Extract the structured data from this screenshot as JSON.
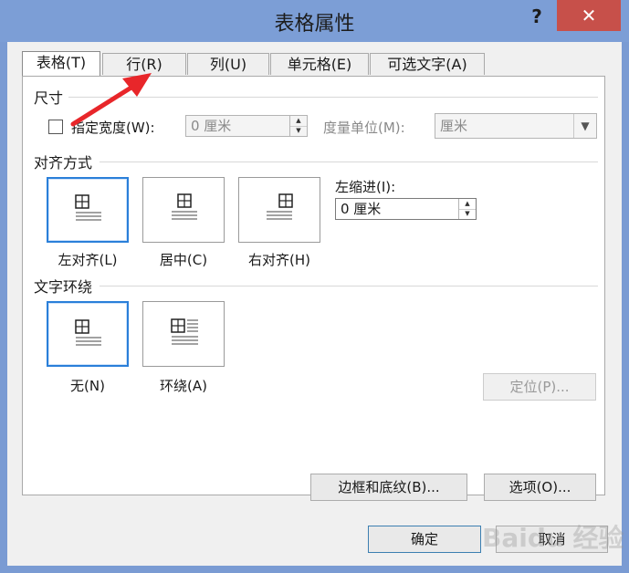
{
  "window": {
    "title": "表格属性",
    "help": "?",
    "close": "✕"
  },
  "tabs": [
    "表格(T)",
    "行(R)",
    "列(U)",
    "单元格(E)",
    "可选文字(A)"
  ],
  "size": {
    "section": "尺寸",
    "preferred_width_label": "指定宽度(W):",
    "preferred_width_value": "0 厘米",
    "measure_label": "度量单位(M):",
    "measure_value": "厘米"
  },
  "alignment": {
    "section": "对齐方式",
    "options": [
      "左对齐(L)",
      "居中(C)",
      "右对齐(H)"
    ],
    "indent_label": "左缩进(I):",
    "indent_value": "0 厘米"
  },
  "wrapping": {
    "section": "文字环绕",
    "options": [
      "无(N)",
      "环绕(A)"
    ],
    "position_button": "定位(P)..."
  },
  "buttons": {
    "borders": "边框和底纹(B)...",
    "options": "选项(O)...",
    "ok": "确定",
    "cancel": "取消"
  },
  "colors": {
    "titlebar": "#7c9ed6",
    "close": "#c7504a",
    "selected_border": "#2a7fd9",
    "annotation_arrow": "#e8262a"
  },
  "watermark": "Baidu 经验"
}
